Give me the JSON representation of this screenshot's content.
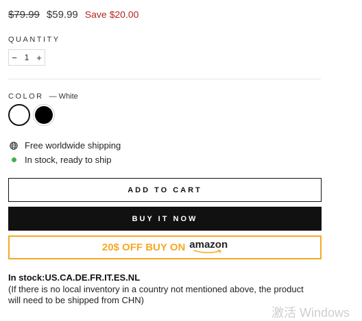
{
  "price": {
    "compare_at": "$79.99",
    "current": "$59.99",
    "savings": "Save $20.00"
  },
  "quantity": {
    "label": "QUANTITY",
    "value": "1",
    "decrement": "−",
    "increment": "+"
  },
  "color": {
    "label": "COLOR",
    "selected": "— White",
    "options": [
      "White",
      "Black"
    ]
  },
  "info": {
    "shipping": "Free worldwide shipping",
    "stock": "In stock, ready to ship"
  },
  "buttons": {
    "add_to_cart": "ADD TO CART",
    "buy_now": "BUY IT NOW",
    "amazon_promo": "20$ OFF BUY ON",
    "amazon_logo": "amazon"
  },
  "availability": {
    "countries": "In stock:US.CA.DE.FR.IT.ES.NL",
    "note": "(If there is no local inventory in a country not mentioned above, the product will need to be shipped from CHN)"
  },
  "watermark": "激活 Windows",
  "colors": {
    "savings_red": "#b3261e",
    "in_stock_green": "#43b04a",
    "amazon_orange": "#f7a823",
    "buy_now_bg": "#111111"
  }
}
